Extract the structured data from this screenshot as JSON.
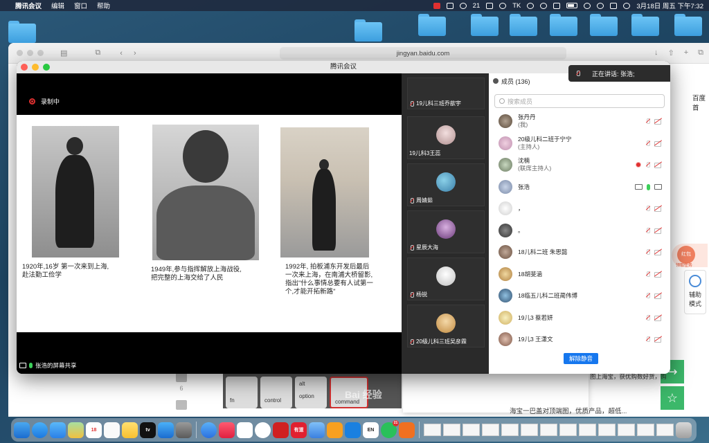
{
  "menubar": {
    "app_name": "腾讯会议",
    "menus": [
      "编辑",
      "窗口",
      "帮助"
    ],
    "wechat_count": "21",
    "tk": "TK",
    "datetime": "3月18日 周五 下午7:32"
  },
  "browser": {
    "url": "jingyan.baidu.com",
    "side_text": "百度首",
    "like_count": "6",
    "bottom_text": "海宝一巴盖对顶端图，优质产品，超低...",
    "article_text": "图上海宝，获优购数好货，购",
    "rb_badge": "红包",
    "rb_task": "领取任务",
    "helper_label_1": "辅",
    "helper_label_2": "助",
    "helper_label_3": "模式",
    "keys": [
      "fn",
      "control",
      "option",
      "command"
    ],
    "key_sup": "alt",
    "watermark": "Bai 经验"
  },
  "meeting": {
    "title": "腾讯会议",
    "recording_label": "录制中",
    "share_footer": "张浩的屏幕共享",
    "captions": [
      "1920年,16岁 第一次来到上海,\n赴法勤工俭学",
      "1949年,参与指挥解放上海战役,\n把完整的上海交给了人民",
      "1992年,  拍板浦东开发后最后\n一次来上海，在南浦大桥留影,\n 指出\"什么事情总要有人试第一\n个,才能开拓新路\""
    ],
    "tiles": [
      {
        "name": "19儿科三班乔歆宇"
      },
      {
        "name": "19儿科3王蕊"
      },
      {
        "name": "周婧茹"
      },
      {
        "name": "星辰大海"
      },
      {
        "name": "杨锐"
      },
      {
        "name": "20级儿科三班吴彦霖"
      }
    ],
    "members_header": "成员 (136)",
    "speaking": "正在讲话: 张浩;",
    "search_placeholder": "搜索成员",
    "members": [
      {
        "name": "张丹丹",
        "role": "(我)"
      },
      {
        "name": "20级儿科二班于宁宁",
        "role": "(主持人)"
      },
      {
        "name": "沈楠",
        "role": "(联席主持人)"
      },
      {
        "name": "张浩",
        "role": ""
      },
      {
        "name": "，",
        "role": ""
      },
      {
        "name": "。",
        "role": ""
      },
      {
        "name": "18儿科二班 朱思懿",
        "role": ""
      },
      {
        "name": "18胡斐涵",
        "role": ""
      },
      {
        "name": "18临五儿科二班蔺伟博",
        "role": ""
      },
      {
        "name": "19儿3 蔡若妍",
        "role": ""
      },
      {
        "name": "19儿3 王潇文",
        "role": ""
      }
    ],
    "unmute_button": "解除静音"
  },
  "dock": {
    "calendar_day": "18",
    "wechat_badge": "21",
    "labels": {
      "tv": "tv",
      "en": "EN",
      "youdao": "有道"
    }
  }
}
